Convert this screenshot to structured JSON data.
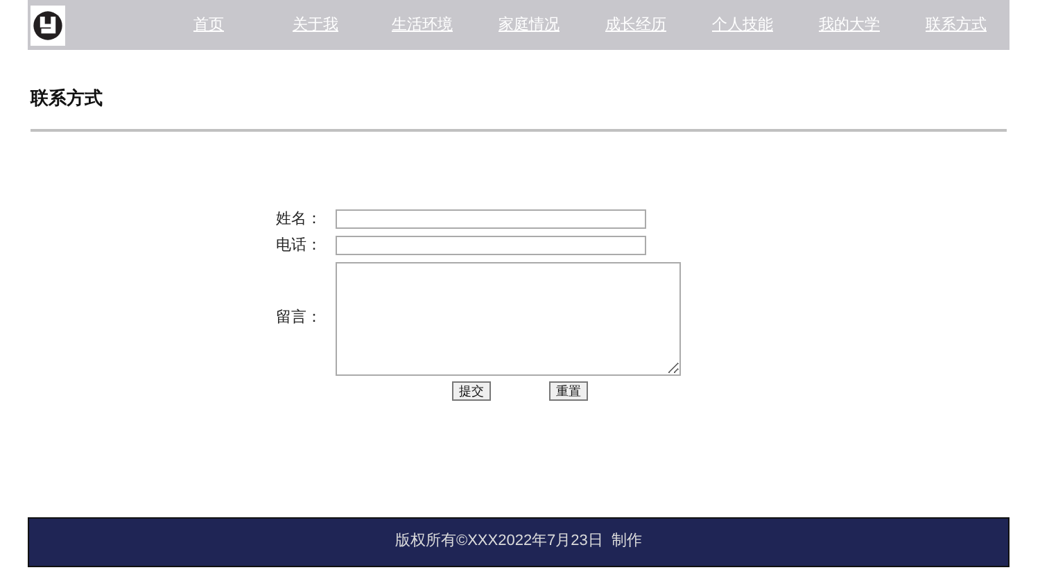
{
  "nav": {
    "items": [
      {
        "label": "首页"
      },
      {
        "label": "关于我"
      },
      {
        "label": "生活环境"
      },
      {
        "label": "家庭情况"
      },
      {
        "label": "成长经历"
      },
      {
        "label": "个人技能"
      },
      {
        "label": "我的大学"
      },
      {
        "label": "联系方式"
      }
    ]
  },
  "heading": "联系方式",
  "form": {
    "fields": [
      {
        "label": "姓名：",
        "kind": "input"
      },
      {
        "label": "电话：",
        "kind": "input"
      },
      {
        "label": "留言：",
        "kind": "textarea"
      }
    ],
    "buttons": [
      "提交",
      "重置"
    ]
  },
  "footer": "版权所有©XXX2022年7月23日  制作"
}
